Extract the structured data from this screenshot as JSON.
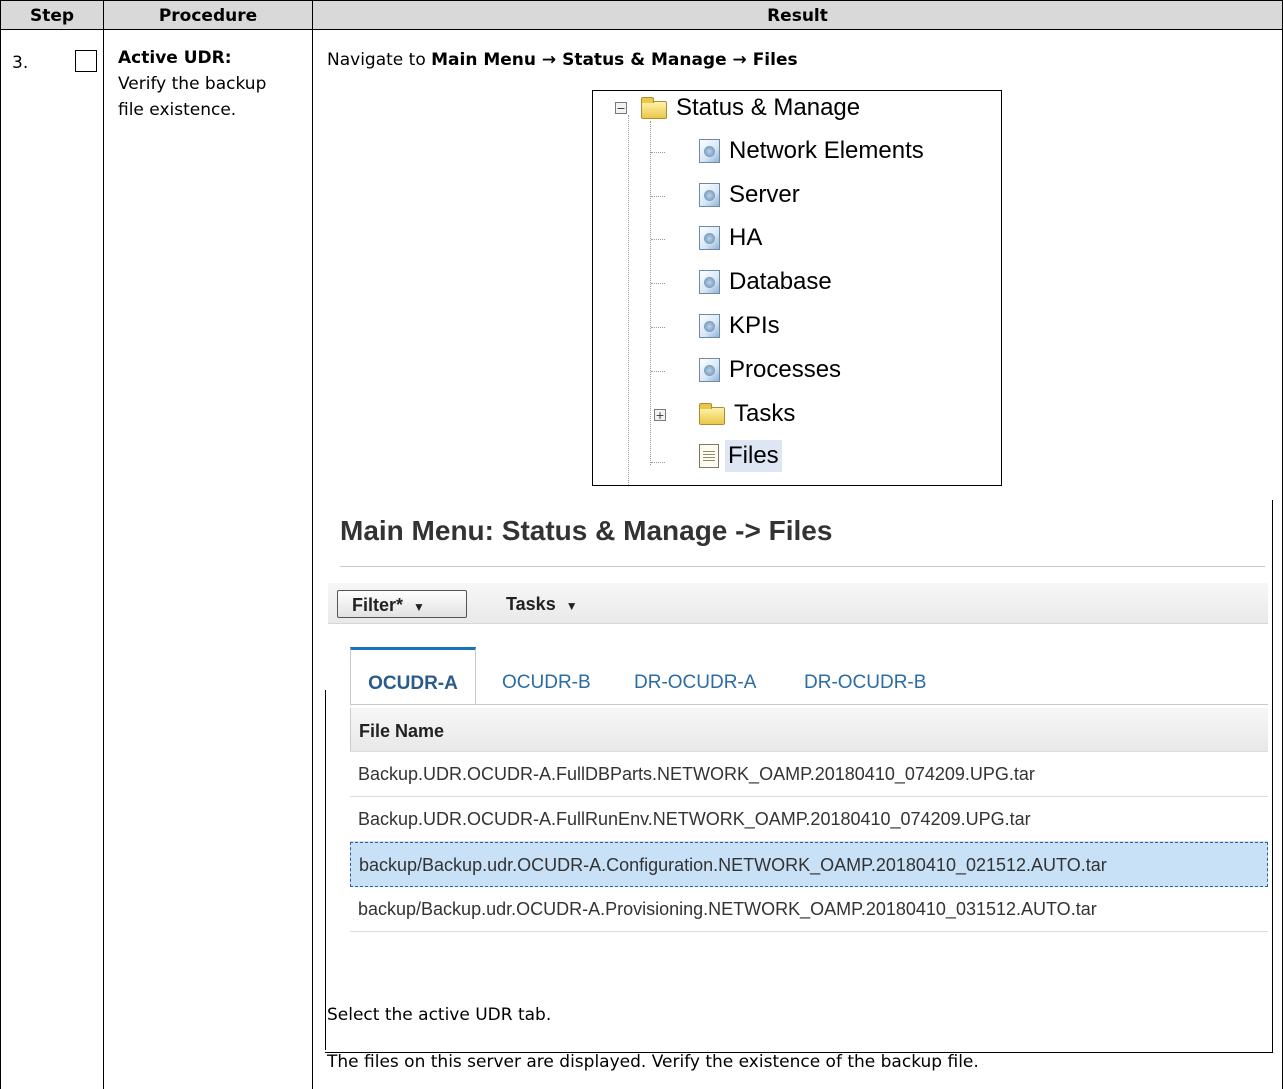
{
  "table": {
    "headers": [
      "Step",
      "Procedure",
      "Result"
    ],
    "step_number": "3.",
    "procedure_bold": "Active UDR:",
    "procedure_text": "Verify the backup file existence."
  },
  "navigate": {
    "prefix": "Navigate to ",
    "path": "Main Menu → Status & Manage → Files"
  },
  "tree": {
    "root": "Status & Manage",
    "root_toggle": "−",
    "items": [
      "Network Elements",
      "Server",
      "HA",
      "Database",
      "KPIs",
      "Processes",
      "Tasks",
      "Files"
    ],
    "tasks_toggle": "+"
  },
  "files_page": {
    "title": "Main Menu: Status & Manage -> Files",
    "toolbar": {
      "filter_label": "Filter*",
      "tasks_label": "Tasks",
      "caret": "▼"
    },
    "tabs": [
      "OCUDR-A",
      "OCUDR-B",
      "DR-OCUDR-A",
      "DR-OCUDR-B"
    ],
    "active_tab": "OCUDR-A",
    "column_header": "File Name",
    "rows": [
      "Backup.UDR.OCUDR-A.FullDBParts.NETWORK_OAMP.20180410_074209.UPG.tar",
      "Backup.UDR.OCUDR-A.FullRunEnv.NETWORK_OAMP.20180410_074209.UPG.tar",
      "backup/Backup.udr.OCUDR-A.Configuration.NETWORK_OAMP.20180410_021512.AUTO.tar",
      "backup/Backup.udr.OCUDR-A.Provisioning.NETWORK_OAMP.20180410_031512.AUTO.tar"
    ],
    "selected_row_index": 2
  },
  "instructions": [
    "Select the active UDR tab.",
    "The files on this server are displayed. Verify the existence of the backup file."
  ]
}
